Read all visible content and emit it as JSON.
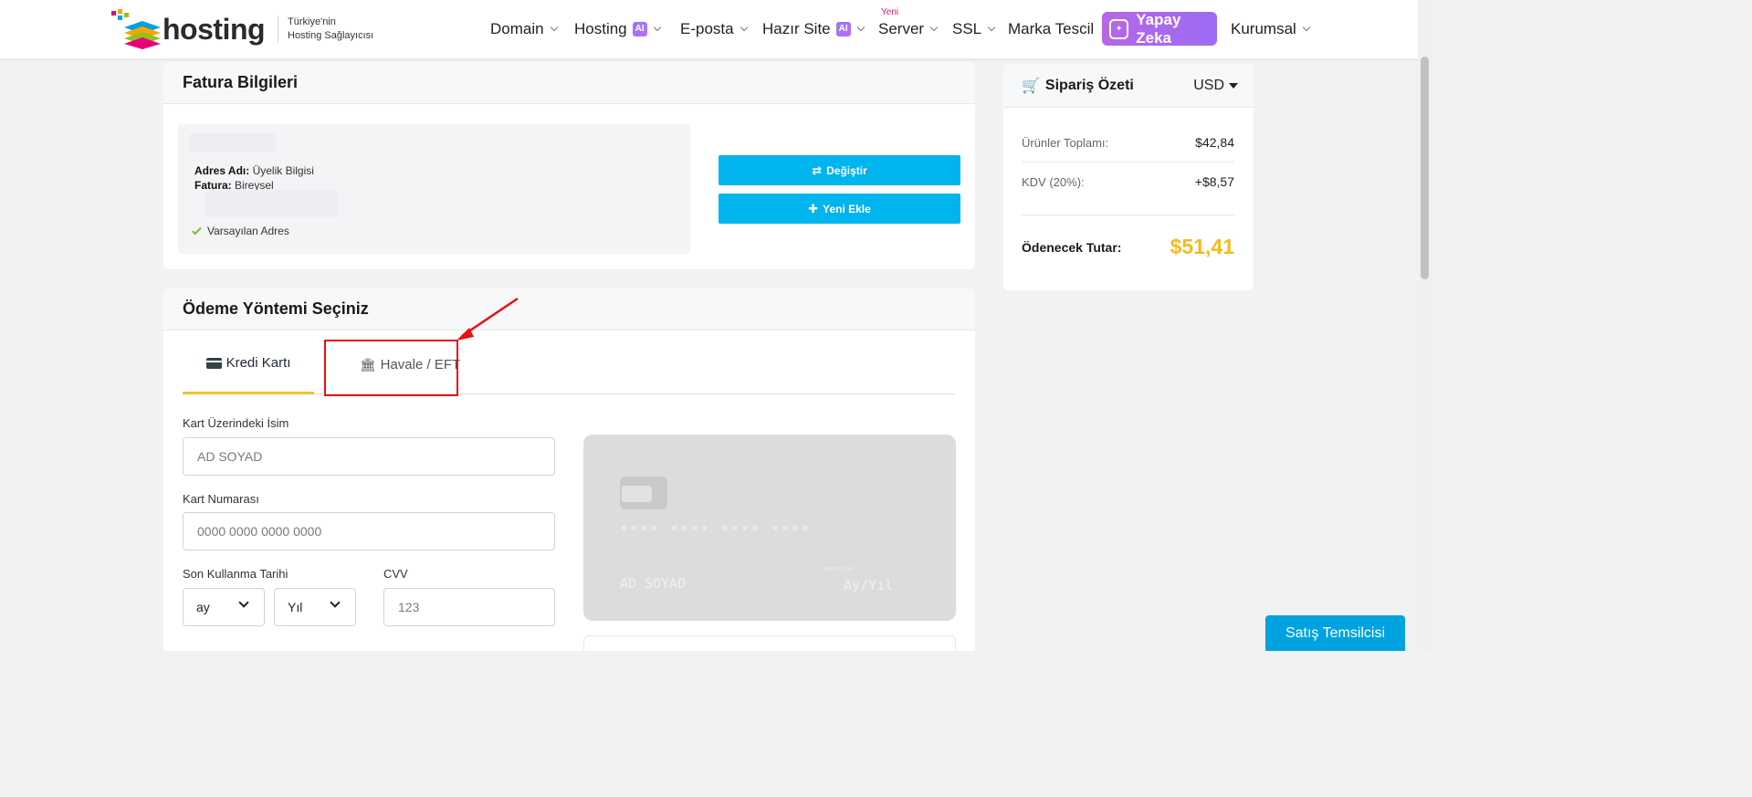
{
  "brand": {
    "name": "hosting",
    "tagline_1": "Türkiye'nin",
    "tagline_2": "Hosting Sağlayıcısı"
  },
  "nav": {
    "domain": "Domain",
    "hosting": "Hosting",
    "ai_badge": "AI",
    "eposta": "E-posta",
    "hazir_site": "Hazır Site",
    "server": "Server",
    "server_badge": "Yeni",
    "ssl": "SSL",
    "marka": "Marka Tescil",
    "yapay_zeka": "Yapay Zeka",
    "kurumsal": "Kurumsal"
  },
  "billing": {
    "title": "Fatura Bilgileri",
    "address_label": "Adres Adı:",
    "address_value": " Üyelik Bilgisi",
    "invoice_label": "Fatura:",
    "invoice_value": " Bireysel",
    "default_address": "Varsayılan Adres",
    "change_button": "Değiştir",
    "add_button": "Yeni Ekle"
  },
  "payment": {
    "title": "Ödeme Yöntemi Seçiniz",
    "tab_card": "Kredi Kartı",
    "tab_transfer": "Havale / EFT",
    "name_label": "Kart Üzerindeki İsim",
    "name_placeholder": "AD SOYAD",
    "number_label": "Kart Numarası",
    "number_placeholder": "0000 0000 0000 0000",
    "expiry_label": "Son Kullanma Tarihi",
    "month_value": "ay",
    "year_value": "Yıl",
    "cvv_label": "CVV",
    "cvv_placeholder": "123",
    "card_preview": {
      "number": "**** **** **** ****",
      "name": "AD SOYAD",
      "expiry": "Ay/Yıl",
      "small": "MONTH/YEAR"
    }
  },
  "summary": {
    "title": "Sipariş Özeti",
    "currency": "USD",
    "subtotal_label": "Ürünler Toplamı:",
    "subtotal_value": "$42,84",
    "tax_label": "KDV (20%):",
    "tax_value": "+$8,57",
    "total_label": "Ödenecek Tutar:",
    "total_value": "$51,41"
  },
  "chat_button": "Satış Temsilcisi",
  "colors": {
    "accent_blue": "#00b4ee",
    "tab_underline": "#f2c230",
    "total": "#f4bb1d",
    "highlight": "#e81010"
  }
}
